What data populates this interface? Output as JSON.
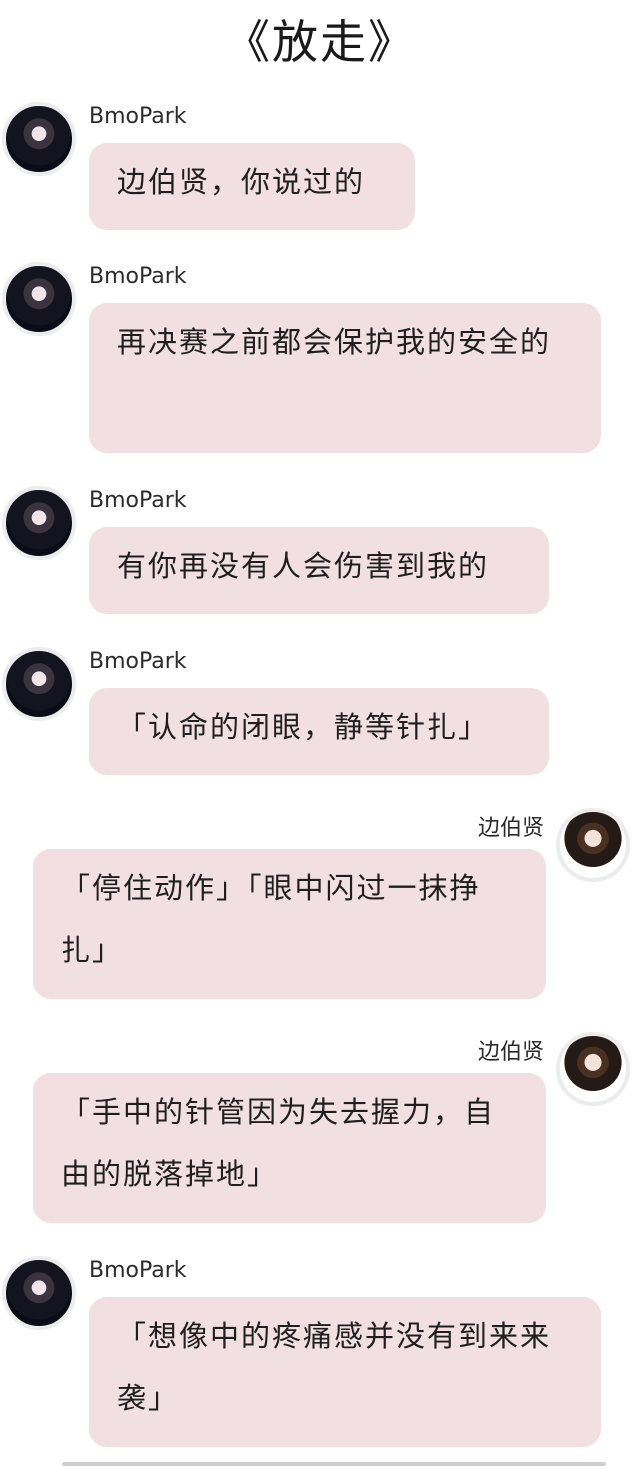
{
  "page_title": "《放走》",
  "messages": [
    {
      "sender": "BmoPark",
      "text": "边伯贤，你说过的"
    },
    {
      "sender": "BmoPark",
      "text": "再决赛之前都会保护我的安全的"
    },
    {
      "sender": "BmoPark",
      "text": "有你再没有人会伤害到我的"
    },
    {
      "sender": "BmoPark",
      "text": "「认命的闭眼，静等针扎」"
    },
    {
      "sender": "边伯贤",
      "text": "「停住动作」「眼中闪过一抹挣扎」"
    },
    {
      "sender": "边伯贤",
      "text": "「手中的针管因为失去握力，自由的脱落掉地」"
    },
    {
      "sender": "BmoPark",
      "text": "「想像中的疼痛感并没有到来来袭」"
    }
  ]
}
